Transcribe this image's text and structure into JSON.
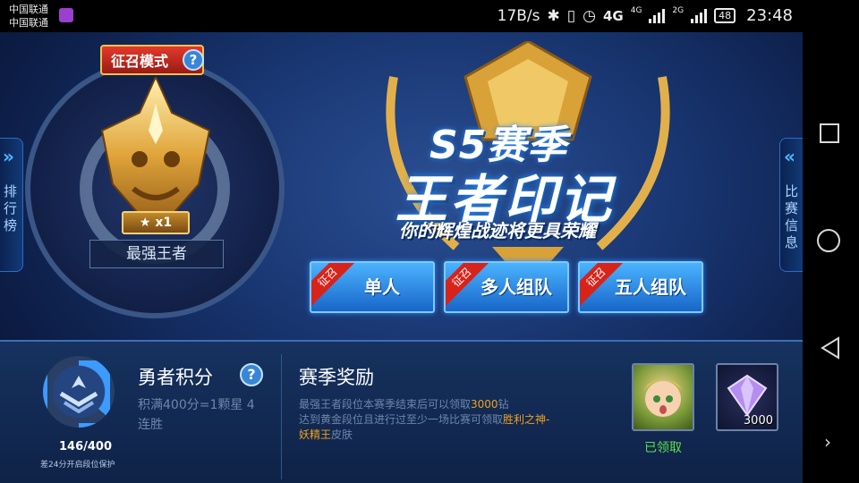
{
  "status_bar": {
    "carrier_1": "中国联通",
    "carrier_2": "中国联通",
    "net_speed": "17B/s",
    "network_4g": "4G",
    "network_4g_small": "4G",
    "network_2g": "2G",
    "battery": "48",
    "time": "23:48"
  },
  "left_tab": {
    "label": "排行榜"
  },
  "right_tab": {
    "label": "比赛信息"
  },
  "rank": {
    "mode_label": "征召模式",
    "help": "?",
    "count": "x1",
    "name": "最强王者"
  },
  "banner": {
    "title_line1": "S5赛季",
    "title_line2": "王者印记",
    "subtitle": "你的辉煌战迹将更具荣耀"
  },
  "mode_buttons": [
    {
      "tag": "征召",
      "label": "单人"
    },
    {
      "tag": "征召",
      "label": "多人组队"
    },
    {
      "tag": "征召",
      "label": "五人组队"
    }
  ],
  "score": {
    "title": "勇者积分",
    "help": "?",
    "desc": "积满400分=1颗星 4连胜",
    "value": "146/400",
    "progress": 0.365,
    "note": "差24分开启段位保护"
  },
  "reward": {
    "title": "赛季奖励",
    "desc_1_pre": "最强王者段位本赛季结束后可以领取",
    "desc_1_hl": "3000",
    "desc_1_post": "钻",
    "desc_2_pre": "达到黄金段位且进行过至少一场比赛可领取",
    "desc_2_hl": "胜利之神-妖精王",
    "desc_2_post": "皮肤",
    "hero_caption": "已领取",
    "gem_count": "3000"
  },
  "colors": {
    "accent_blue": "#3d9bff",
    "highlight_orange": "#f0a21e",
    "claimed_green": "#5de04a",
    "tag_red": "#d8231b"
  }
}
